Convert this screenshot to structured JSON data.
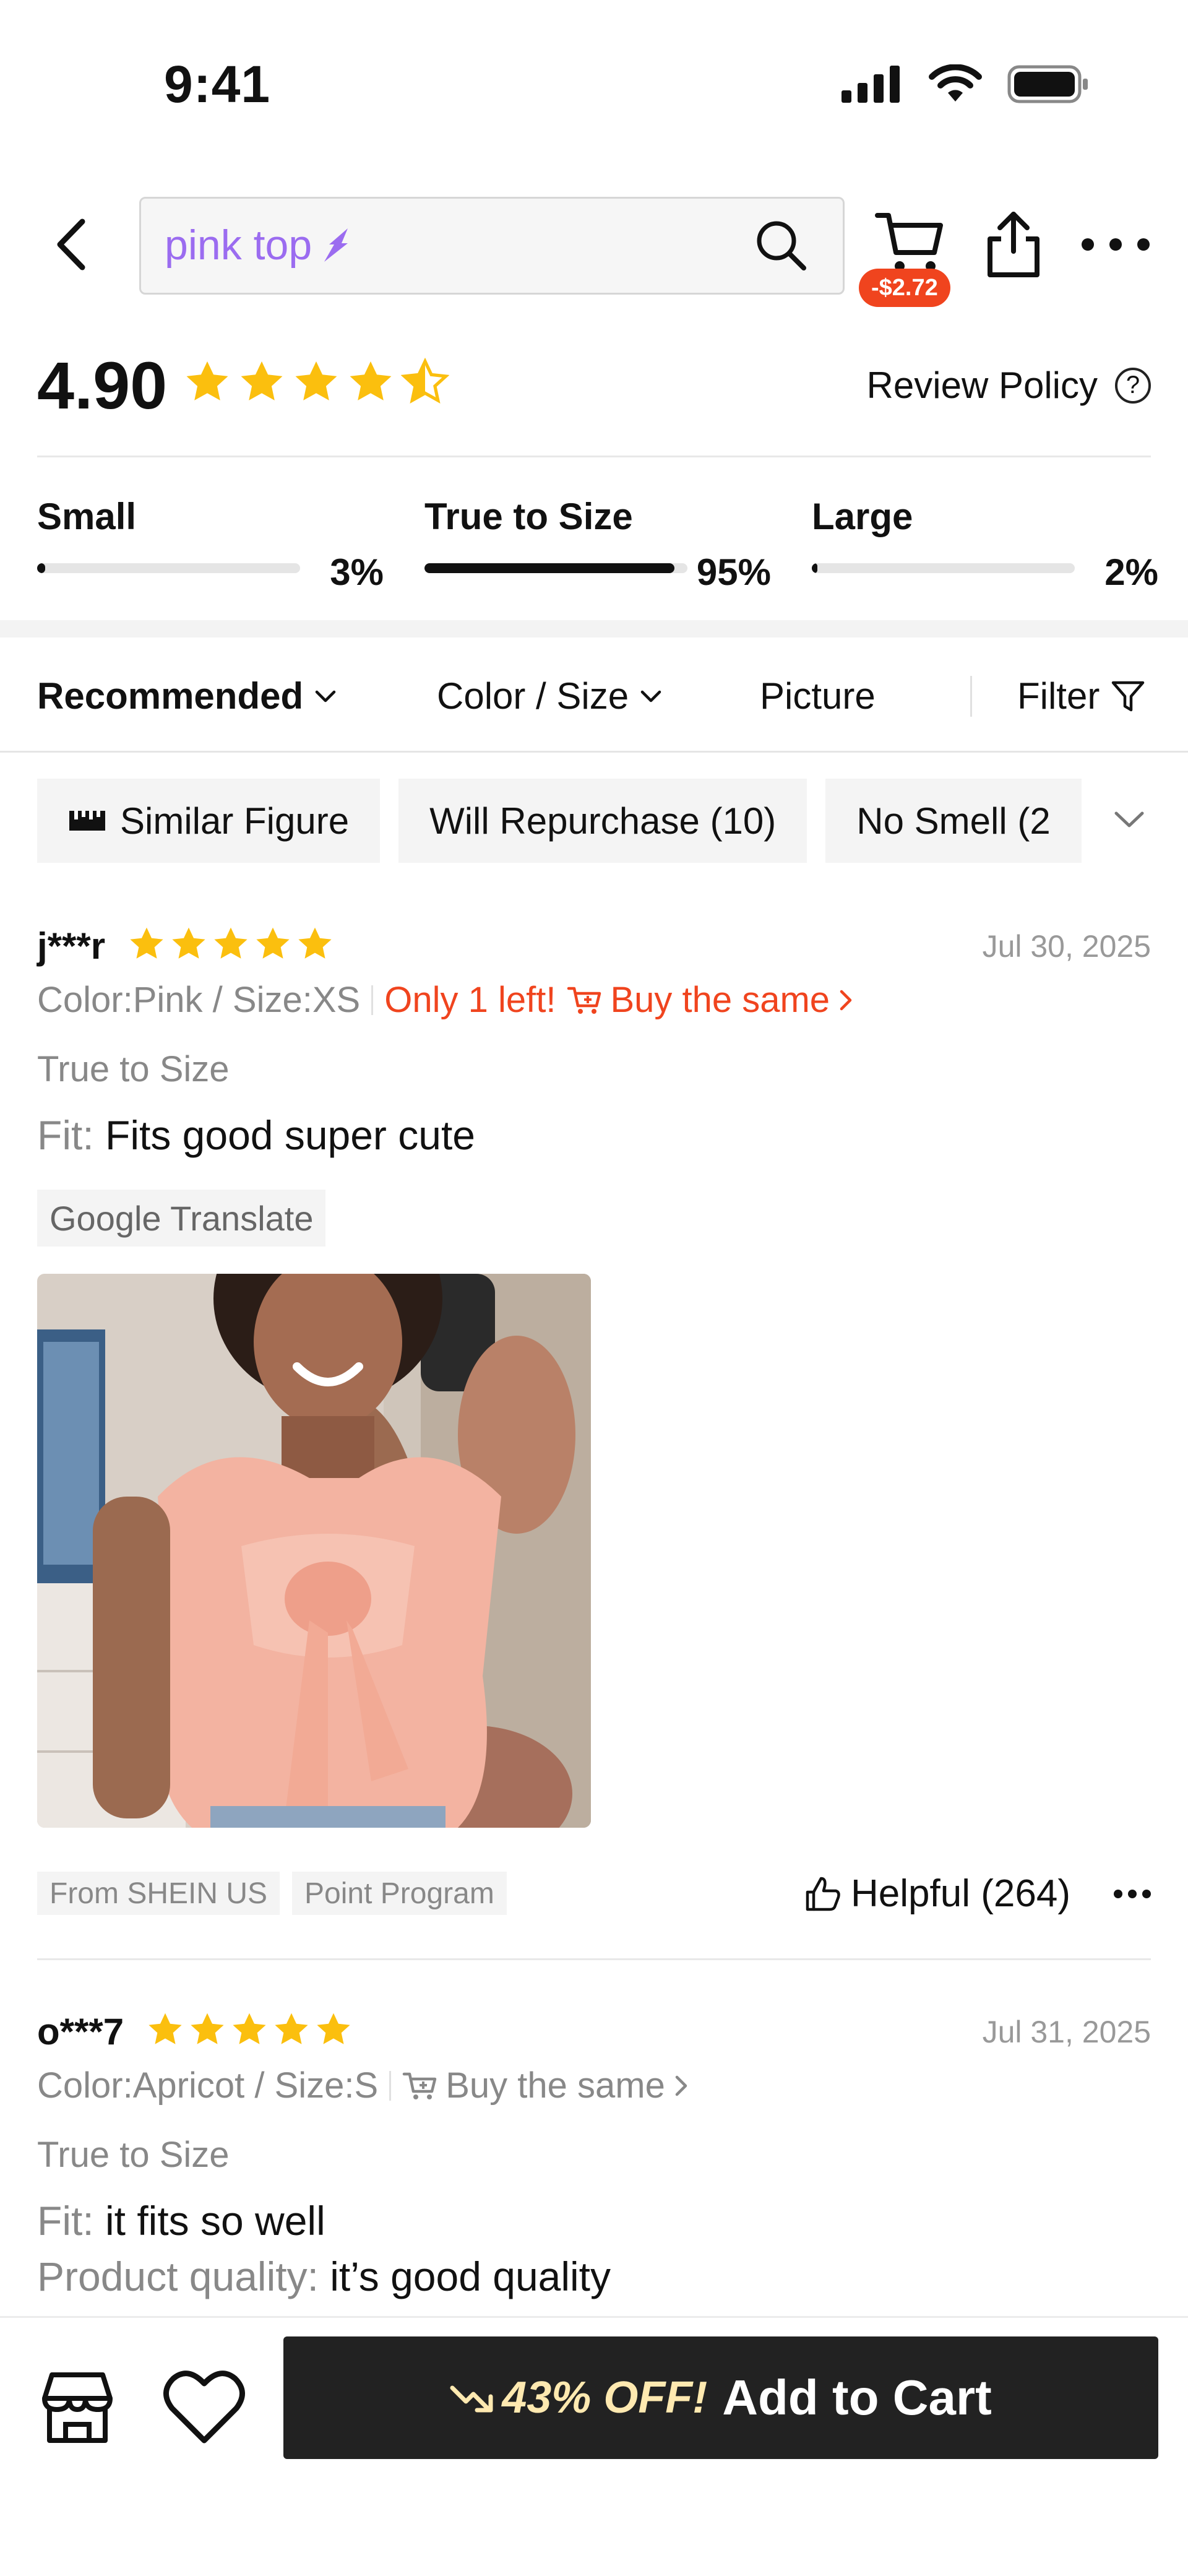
{
  "status_bar": {
    "time": "9:41"
  },
  "search": {
    "query": "pink top",
    "cart_badge": "-$2.72"
  },
  "rating": {
    "score": "4.90",
    "stars": 4.5,
    "policy_label": "Review Policy",
    "policy_icon": "?"
  },
  "fit": [
    {
      "label": "Small",
      "percent": 3,
      "percent_text": "3%"
    },
    {
      "label": "True to Size",
      "percent": 95,
      "percent_text": "95%"
    },
    {
      "label": "Large",
      "percent": 2,
      "percent_text": "2%"
    }
  ],
  "sort": {
    "recommended": "Recommended",
    "color_size": "Color / Size",
    "picture": "Picture",
    "filter": "Filter"
  },
  "tags": [
    "Similar Figure",
    "Will Repurchase (10)",
    "No Smell (2"
  ],
  "reviews": [
    {
      "user": "j***r",
      "stars": 5,
      "date": "Jul 30, 2025",
      "variant": "Color:Pink / Size:XS",
      "stock_note": "Only 1 left!",
      "buy_same": "Buy the same",
      "size_feedback": "True to Size",
      "fit_key": "Fit:",
      "fit_text": "Fits good super cute",
      "translate": "Google Translate",
      "chips": [
        "From SHEIN US",
        "Point Program"
      ],
      "helpful": "Helpful (264)"
    },
    {
      "user": "o***7",
      "stars": 5,
      "date": "Jul 31, 2025",
      "variant": "Color:Apricot / Size:S",
      "buy_same": "Buy the same",
      "size_feedback": "True to Size",
      "fit_key": "Fit:",
      "fit_text": "it fits so well",
      "quality_key": "Product quality:",
      "quality_text": "it’s good quality"
    }
  ],
  "bottom": {
    "discount": "43% OFF!",
    "add_to_cart": "Add to Cart"
  },
  "colors": {
    "accent_orange": "#f0441e",
    "star": "#fbbf0e",
    "search_purple": "#9b6cf0",
    "cta_bg": "#222222"
  }
}
